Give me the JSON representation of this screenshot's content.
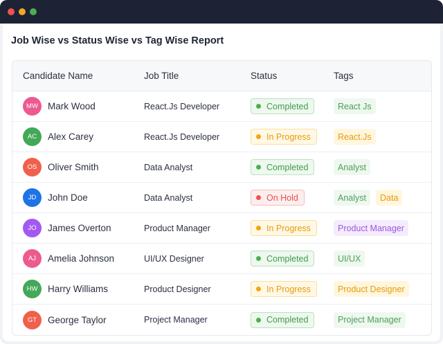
{
  "window": {
    "dots": [
      "#ef5350",
      "#f5a623",
      "#4caf50"
    ]
  },
  "report_title": "Job Wise vs Status Wise vs Tag Wise Report",
  "table": {
    "headers": {
      "candidate": "Candidate Name",
      "job": "Job Title",
      "status": "Status",
      "tags": "Tags"
    },
    "rows": [
      {
        "initials": "MW",
        "avatar_color": "#ec5a8f",
        "name": "Mark Wood",
        "job": "React.Js Developer",
        "status": "Completed",
        "status_kind": "completed",
        "tags": [
          {
            "label": "React Js",
            "kind": "green"
          }
        ]
      },
      {
        "initials": "AC",
        "avatar_color": "#43a858",
        "name": "Alex Carey",
        "job": "React.Js Developer",
        "status": "In Progress",
        "status_kind": "progress",
        "tags": [
          {
            "label": "React.Js",
            "kind": "yellow"
          }
        ]
      },
      {
        "initials": "OS",
        "avatar_color": "#f0604d",
        "name": "Oliver Smith",
        "job": "Data Analyst",
        "status": "Completed",
        "status_kind": "completed",
        "tags": [
          {
            "label": "Analyst",
            "kind": "green"
          }
        ]
      },
      {
        "initials": "JD",
        "avatar_color": "#1e74e6",
        "name": "John Doe",
        "job": "Data Analyst",
        "status": "On Hold",
        "status_kind": "hold",
        "tags": [
          {
            "label": "Analyst",
            "kind": "green"
          },
          {
            "label": "Data",
            "kind": "yellow"
          }
        ]
      },
      {
        "initials": "JO",
        "avatar_color": "#a35af0",
        "name": "James Overton",
        "job": "Product Manager",
        "status": "In Progress",
        "status_kind": "progress",
        "tags": [
          {
            "label": "Product Manager",
            "kind": "purple"
          }
        ]
      },
      {
        "initials": "AJ",
        "avatar_color": "#ec5a8f",
        "name": "Amelia Johnson",
        "job": "UI/UX Designer",
        "status": "Completed",
        "status_kind": "completed",
        "tags": [
          {
            "label": "UI/UX",
            "kind": "green"
          }
        ]
      },
      {
        "initials": "HW",
        "avatar_color": "#43a858",
        "name": "Harry Williams",
        "job": "Product Designer",
        "status": "In Progress",
        "status_kind": "progress",
        "tags": [
          {
            "label": "Product Designer",
            "kind": "yellow"
          }
        ]
      },
      {
        "initials": "GT",
        "avatar_color": "#f0604d",
        "name": "George Taylor",
        "job": "Project Manager",
        "status": "Completed",
        "status_kind": "completed",
        "tags": [
          {
            "label": "Project Manager",
            "kind": "green"
          }
        ]
      }
    ]
  },
  "colors": {
    "completed": {
      "text": "#3f9c4d",
      "bg": "#eef8ef",
      "border": "#b9e2bf",
      "dot": "#4caf50"
    },
    "progress": {
      "text": "#e89b0c",
      "bg": "#fff8e6",
      "border": "#fbdf9c",
      "dot": "#f5a50f"
    },
    "hold": {
      "text": "#e65050",
      "bg": "#fdeeee",
      "border": "#f6bcbc",
      "dot": "#ef5350"
    },
    "tag_green": {
      "text": "#4d9e5a",
      "bg": "#eef8ef"
    },
    "tag_yellow": {
      "text": "#e89b0c",
      "bg": "#fff6de"
    },
    "tag_purple": {
      "text": "#9b55e0",
      "bg": "#f4ecfd"
    }
  }
}
